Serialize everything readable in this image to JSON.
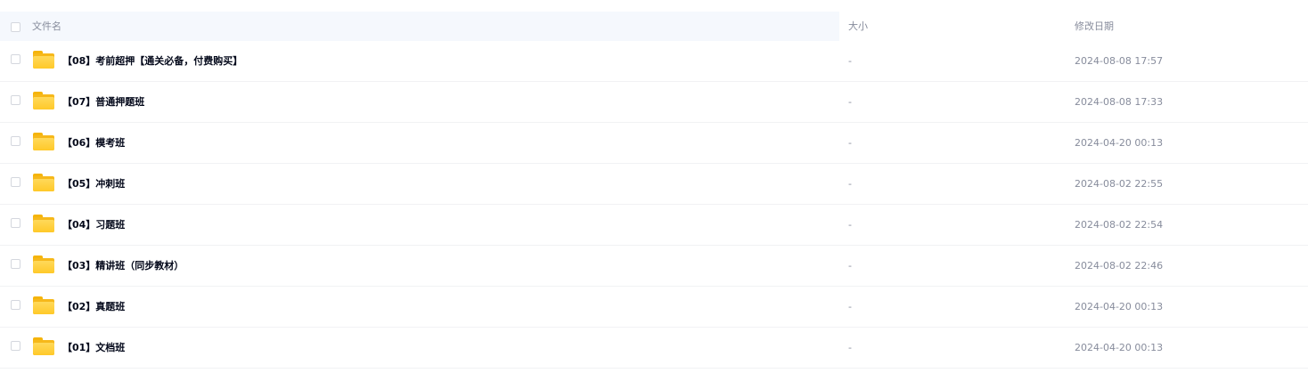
{
  "header": {
    "name": "文件名",
    "size": "大小",
    "modified": "修改日期"
  },
  "files": [
    {
      "name": "【08】考前超押【通关必备，付费购买】",
      "size": "-",
      "modified": "2024-08-08 17:57",
      "icon": "folder-icon"
    },
    {
      "name": "【07】普通押题班",
      "size": "-",
      "modified": "2024-08-08 17:33",
      "icon": "folder-icon"
    },
    {
      "name": "【06】模考班",
      "size": "-",
      "modified": "2024-04-20 00:13",
      "icon": "folder-icon"
    },
    {
      "name": "【05】冲刺班",
      "size": "-",
      "modified": "2024-08-02 22:55",
      "icon": "folder-icon"
    },
    {
      "name": "【04】习题班",
      "size": "-",
      "modified": "2024-08-02 22:54",
      "icon": "folder-icon"
    },
    {
      "name": "【03】精讲班（同步教材）",
      "size": "-",
      "modified": "2024-08-02 22:46",
      "icon": "folder-icon"
    },
    {
      "name": "【02】真题班",
      "size": "-",
      "modified": "2024-04-20 00:13",
      "icon": "folder-icon"
    },
    {
      "name": "【01】文档班",
      "size": "-",
      "modified": "2024-04-20 00:13",
      "icon": "folder-icon"
    }
  ],
  "colors": {
    "header_bg": "#f5f8fd",
    "muted_text": "#878c9c",
    "primary_text": "#03081a",
    "folder_yellow": "#ffc929"
  }
}
